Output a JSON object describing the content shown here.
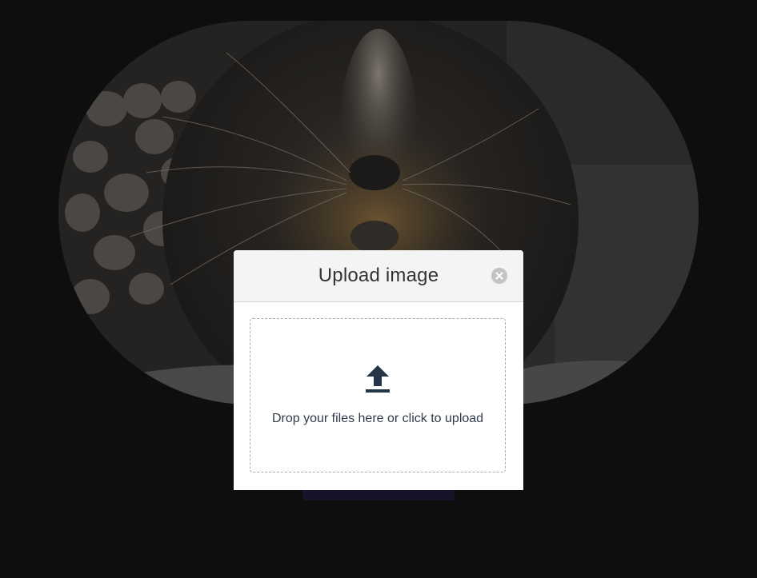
{
  "modal": {
    "title": "Upload image",
    "close_icon": "close-circle-icon",
    "dropzone": {
      "icon": "upload-icon",
      "text": "Drop your files here or click to upload"
    }
  },
  "colors": {
    "page_background": "#0e0e0f",
    "modal_header_bg": "#f4f4f4",
    "icon_color": "#2a3a4f",
    "text_color": "#2f3b4a",
    "underlay_button": "#17142a"
  }
}
